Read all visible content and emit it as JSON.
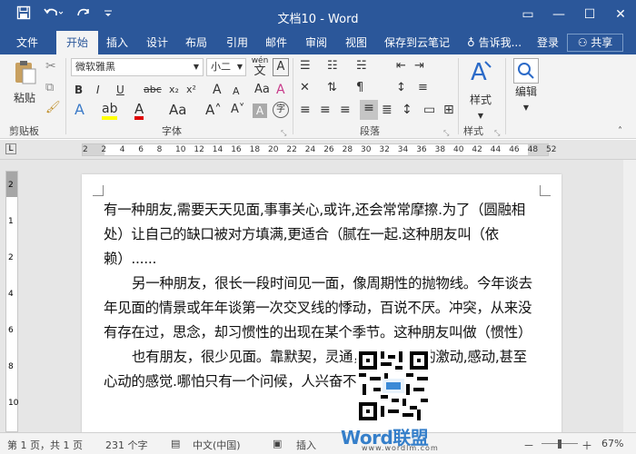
{
  "title_bar": {
    "title": "文档10 - Word",
    "qat": {
      "save_icon": "save-icon",
      "undo_icon": "undo-icon",
      "redo_icon": "redo-icon",
      "customize_icon": "customize-qat-icon"
    },
    "window_controls": {
      "ribbon_display": "▭",
      "minimize": "—",
      "maximize": "☐",
      "close": "✕"
    }
  },
  "tabs": {
    "file": "文件",
    "home": "开始",
    "insert": "插入",
    "design": "设计",
    "layout": "布局",
    "references": "引用",
    "mailings": "邮件",
    "review": "审阅",
    "view": "视图",
    "cloud": "保存到云笔记",
    "tellme": "告诉我...",
    "signin": "登录",
    "share": "共享"
  },
  "ribbon": {
    "clipboard": {
      "paste": "粘贴",
      "label": "剪贴板"
    },
    "font": {
      "name": "微软雅黑",
      "size": "小二",
      "label": "字体",
      "bold": "B",
      "italic": "I",
      "underline": "U",
      "strike": "abc",
      "sub": "x₂",
      "sup": "x²",
      "grow": "A",
      "shrink": "A",
      "clear": "A",
      "wen": "wén",
      "a_char": "A",
      "border_char": "字"
    },
    "paragraph": {
      "label": "段落"
    },
    "styles": {
      "button": "样式",
      "label": "样式"
    },
    "editing": {
      "button": "编辑"
    }
  },
  "ruler": {
    "labels": [
      "2",
      "2",
      "4",
      "6",
      "8",
      "10",
      "12",
      "14",
      "16",
      "18",
      "20",
      "22",
      "24",
      "26",
      "28",
      "30",
      "32",
      "34",
      "36",
      "38",
      "40",
      "42",
      "44",
      "46",
      "48",
      "52"
    ],
    "vertical": [
      "2",
      "1",
      "2",
      "4",
      "6",
      "8",
      "10"
    ]
  },
  "document": {
    "paragraphs": [
      "有一种朋友,需要天天见面,事事关心,或许,还会常常摩擦.为了（圆融相处）让自己的缺口被对方填满,更适合（腻在一起.这种朋友叫（依赖）......",
      "另一种朋友，很长一段时间见一面，像周期性的抛物线。今年谈去年见面的情景或年年谈第一次交叉线的悸动，百说不厌。冲突，从来没有存在过，思念，却习惯性的出现在某个季节。这种朋友叫做（惯性）",
      "也有朋友，很少见面。靠默契，灵通，对方需要的激动,感动,甚至心动的感觉.哪怕只有一个问候，人兴奋不已。这"
    ]
  },
  "status": {
    "page": "第 1 页，共 1 页",
    "words": "231 个字",
    "language": "中文(中国)",
    "mode": "插入",
    "zoom": "67%"
  },
  "watermark": {
    "main": "Word联盟",
    "sub": "www.wordlm.com"
  },
  "colors": {
    "accent": "#2b579a",
    "ribbon": "#f3f3f3",
    "workspace": "#e6e6e6"
  }
}
